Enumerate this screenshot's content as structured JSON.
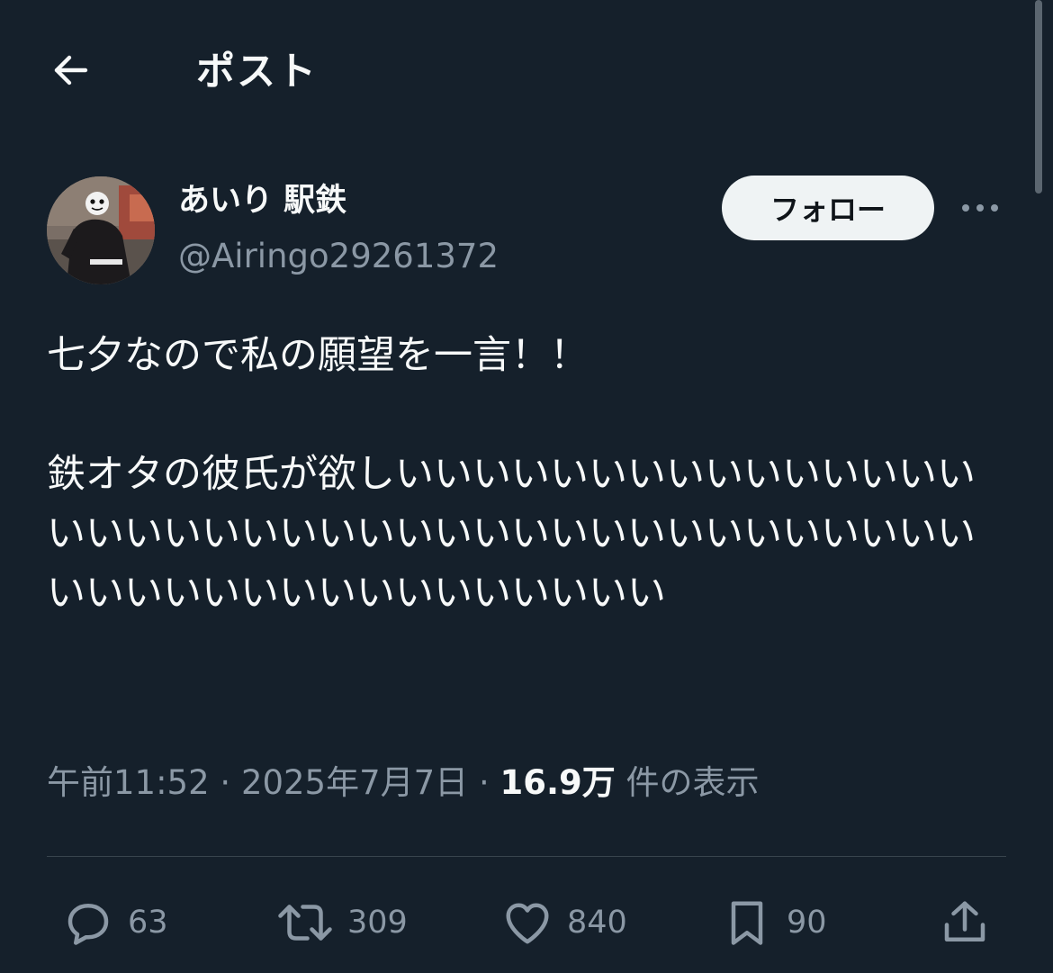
{
  "header": {
    "title": "ポスト",
    "back_icon": "arrow-left-icon"
  },
  "author": {
    "display_name": "あいり 駅鉄",
    "handle": "@Airingo29261372",
    "follow_label": "フォロー",
    "more_icon": "more-horizontal-icon"
  },
  "post": {
    "text": "七夕なので私の願望を一言！！\n\n鉄オタの彼氏が欲しいいいいいいいいいいいいいいいいいいいいいいいいいいいいいいいいいいいいいいいいいいいいいいいいいいいいいいい"
  },
  "meta": {
    "time": "午前11:52",
    "separator": "·",
    "date": "2025年7月7日",
    "views_count": "16.9万",
    "views_label": "件の表示"
  },
  "actions": {
    "replies": "63",
    "reposts": "309",
    "likes": "840",
    "bookmarks": "90"
  },
  "colors": {
    "background": "#15202b",
    "text": "#f7f9f9",
    "secondary_text": "#8b98a5",
    "divider": "#38444d",
    "follow_button_bg": "#eff3f4"
  }
}
